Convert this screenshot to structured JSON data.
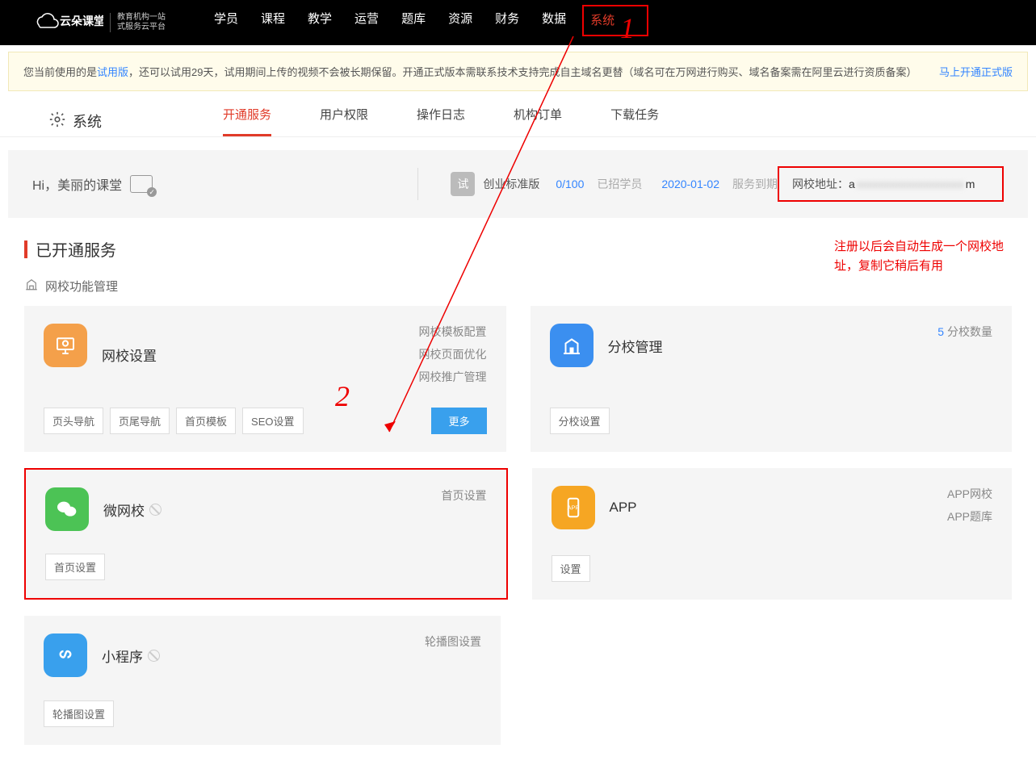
{
  "brand": {
    "name": "云朵课堂",
    "sub1": "教育机构一站",
    "sub2": "式服务云平台"
  },
  "top_nav": [
    "学员",
    "课程",
    "教学",
    "运营",
    "题库",
    "资源",
    "财务",
    "数据",
    "系统"
  ],
  "top_nav_active": "系统",
  "notice": {
    "prefix": "您当前使用的是",
    "trial": "试用版",
    "body": "，还可以试用29天，试用期间上传的视频不会被长期保留。开通正式版本需联系技术支持完成自主域名更替（域名可在万网进行购买、域名备案需在阿里云进行资质备案）",
    "cta": "马上开通正式版"
  },
  "page_title": "系统",
  "sub_tabs": [
    "开通服务",
    "用户权限",
    "操作日志",
    "机构订单",
    "下载任务"
  ],
  "sub_tab_active": "开通服务",
  "greeting": {
    "hi": "Hi，",
    "name": "美丽的课堂"
  },
  "plan": {
    "badge": "试",
    "name": "创业标准版",
    "count": "0/100",
    "count_label": "已招学员",
    "expire": "2020-01-02",
    "expire_label": "服务到期"
  },
  "url": {
    "label": "网校地址：",
    "value_prefix": "a",
    "value_blur": "xxxxxxxxxxxxxxxxxxx",
    "value_suffix": "m"
  },
  "red_note": "注册以后会自动生成一个网校地址，复制它稍后有用",
  "section_title": "已开通服务",
  "subhead": "网校功能管理",
  "cards": {
    "c1": {
      "title": "网校设置",
      "links": [
        "网校模板配置",
        "网校页面优化",
        "网校推广管理"
      ],
      "chips": [
        "页头导航",
        "页尾导航",
        "首页模板",
        "SEO设置"
      ],
      "more": "更多"
    },
    "c2": {
      "title": "分校管理",
      "count": "5",
      "count_label": "分校数量",
      "chips": [
        "分校设置"
      ]
    },
    "c3": {
      "title": "微网校",
      "links": [
        "首页设置"
      ],
      "chips": [
        "首页设置"
      ]
    },
    "c4": {
      "title": "APP",
      "links": [
        "APP网校",
        "APP题库"
      ],
      "chips": [
        "设置"
      ]
    },
    "c5": {
      "title": "小程序",
      "links": [
        "轮播图设置"
      ],
      "chips": [
        "轮播图设置"
      ]
    }
  },
  "annot": {
    "n1": "1",
    "n2": "2"
  }
}
